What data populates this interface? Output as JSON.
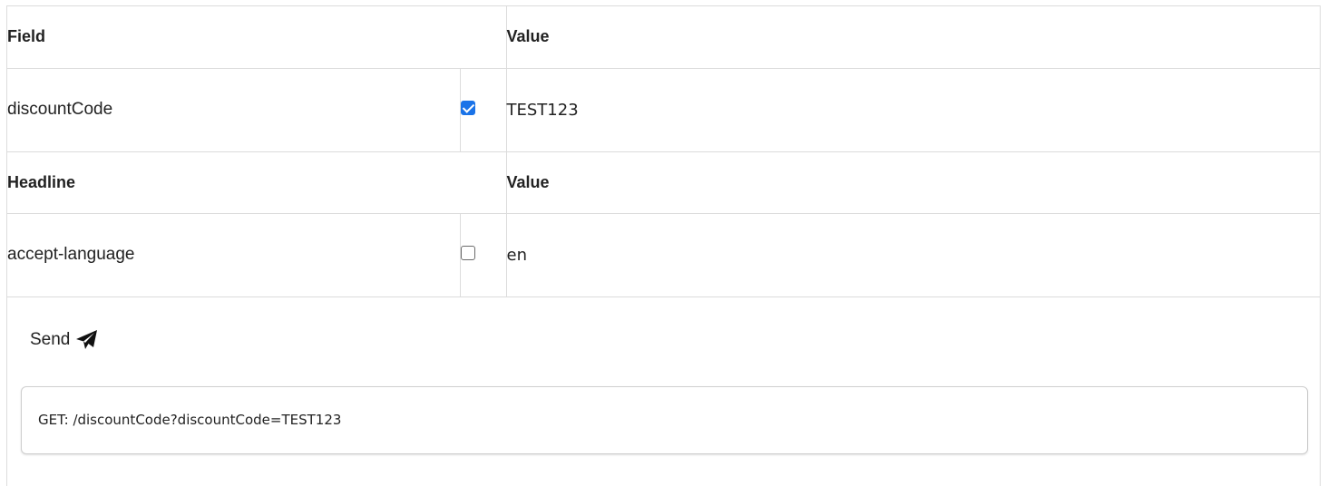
{
  "query_table": {
    "headers": {
      "field": "Field",
      "value": "Value"
    },
    "rows": [
      {
        "name": "discountCode",
        "enabled": true,
        "value": "TEST123"
      }
    ]
  },
  "header_table": {
    "headers": {
      "field": "Headline",
      "value": "Value"
    },
    "rows": [
      {
        "name": "accept-language",
        "enabled": false,
        "value": "en"
      }
    ]
  },
  "send": {
    "label": "Send",
    "icon": "paper-plane-icon"
  },
  "result": {
    "request_line": "GET: /discountCode?discountCode=TEST123"
  },
  "colors": {
    "checkbox_checked": "#1a73e8",
    "border": "#dcdcdc"
  }
}
